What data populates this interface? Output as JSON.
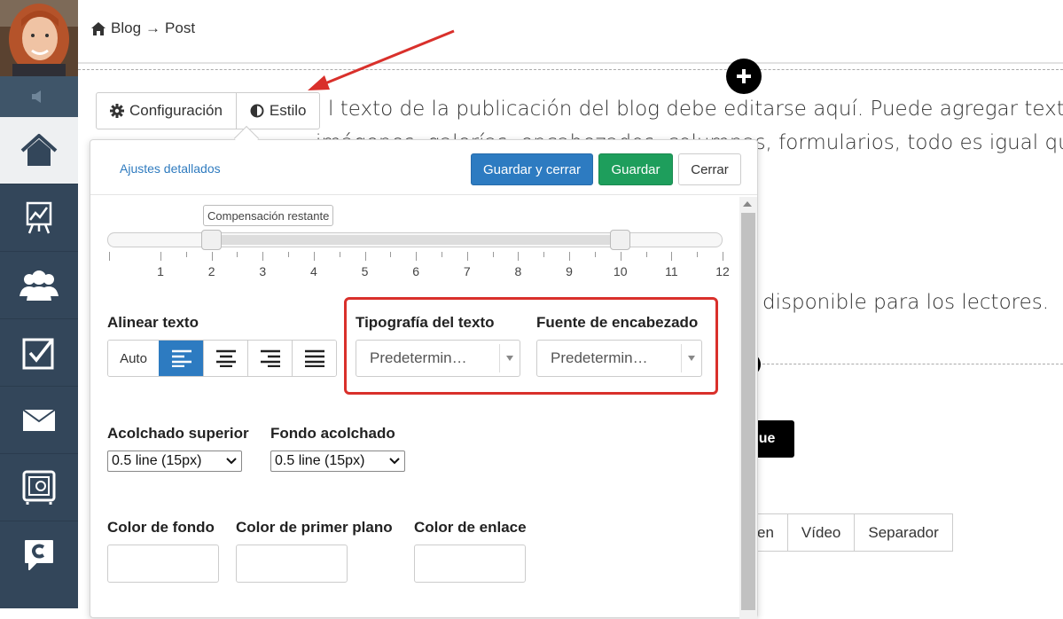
{
  "breadcrumb": {
    "home_label": "Blog",
    "arrow": "→",
    "current": "Post"
  },
  "background": {
    "line1": "l texto de la publicación del blog debe editarse aquí. Puede agregar texto",
    "line2": "imágenes, galerías, encabezados, columnas, formularios, todo es igual que",
    "line3": "disponible para los lectores.",
    "black_button": "que",
    "tabs": [
      "en",
      "Vídeo",
      "Separador"
    ]
  },
  "mode_tabs": {
    "config": "Configuración",
    "style": "Estilo"
  },
  "panel": {
    "detailed_link": "Ajustes detallados",
    "save_close": "Guardar y cerrar",
    "save": "Guardar",
    "close": "Cerrar",
    "slider": {
      "tooltip": "Compensación restante",
      "min": 1,
      "max": 12,
      "value_start": 2,
      "value_end": 10,
      "tick_labels": [
        "1",
        "2",
        "3",
        "4",
        "5",
        "6",
        "7",
        "8",
        "9",
        "10",
        "11",
        "12"
      ]
    },
    "align": {
      "label": "Alinear texto",
      "auto": "Auto",
      "selected": "left"
    },
    "typography": {
      "text_label": "Tipografía del texto",
      "text_value": "Predetermin…",
      "heading_label": "Fuente de encabezado",
      "heading_value": "Predetermin…"
    },
    "padding": {
      "top_label": "Acolchado superior",
      "top_value": "0.5 line (15px)",
      "bottom_label": "Fondo acolchado",
      "bottom_value": "0.5 line (15px)"
    },
    "colors": {
      "background_label": "Color de fondo",
      "foreground_label": "Color de primer plano",
      "link_label": "Color de enlace"
    }
  },
  "theme": {
    "sidebar": "#33465a",
    "primary": "#2d7bc1",
    "success": "#1e9e5c",
    "highlight": "#d9302b"
  },
  "icons": [
    "home-icon",
    "volume-icon",
    "dashboard-icon",
    "chart-icon",
    "users-icon",
    "checkbox-icon",
    "mail-icon",
    "safe-icon",
    "chat-logo-icon",
    "gear-icon",
    "contrast-icon"
  ]
}
